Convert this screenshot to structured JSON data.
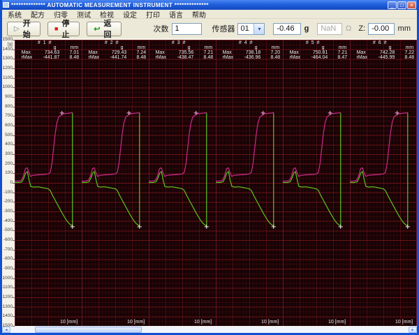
{
  "window": {
    "title": "**************  AUTOMATIC MEASUREMENT INSTRUMENT  **************",
    "controls": {
      "minimize": "_",
      "restore": "□",
      "close": "×"
    }
  },
  "menu": {
    "items": [
      "系统",
      "配方",
      "归零",
      "测试",
      "检视",
      "设定",
      "打印",
      "语言",
      "帮助"
    ]
  },
  "toolbar": {
    "start_label": "开始",
    "stop_label": "停止",
    "return_label": "返回",
    "count_label": "次数",
    "count_value": "1",
    "sensor_label": "传感器",
    "sensor_value": "01",
    "force_value": "-0.46",
    "force_unit": "g",
    "ohm_value": "NaN",
    "ohm_unit": "Ω",
    "z_label": "Z:",
    "z_value": "-0.00",
    "z_unit": "mm"
  },
  "chart_data": {
    "type": "line",
    "y_axis": {
      "unit": "[g]",
      "min": -1500,
      "max": 1500,
      "step": 100
    },
    "x_label": "10 [mm]",
    "legend_position": "none",
    "grid": true,
    "colors": {
      "press": "#cb2a8d",
      "return": "#5fc41e",
      "press_marker": "#f5b6e2",
      "return_marker": "#eaf6ea",
      "divider": "#6e1430",
      "background": "#170305"
    },
    "panels": [
      {
        "index": "# 1 #",
        "col_g": "g",
        "col_mm": "mm",
        "max_label": "Max",
        "rmax_label": "rMax",
        "max_g": "734.63",
        "max_mm": "7.01",
        "rmax_g": "-441.87",
        "rmax_mm": "8.48"
      },
      {
        "index": "# 2 #",
        "col_g": "g",
        "col_mm": "mm",
        "max_label": "Max",
        "rmax_label": "rMax",
        "max_g": "729.43",
        "max_mm": "7.24",
        "rmax_g": "-441.74",
        "rmax_mm": "8.48"
      },
      {
        "index": "# 3 #",
        "col_g": "g",
        "col_mm": "mm",
        "max_label": "Max",
        "rmax_label": "rMax",
        "max_g": "735.56",
        "max_mm": "7.21",
        "rmax_g": "-438.47",
        "rmax_mm": "8.48"
      },
      {
        "index": "# 4 #",
        "col_g": "g",
        "col_mm": "mm",
        "max_label": "Max",
        "rmax_label": "rMax",
        "max_g": "738.18",
        "max_mm": "7.20",
        "rmax_g": "-436.96",
        "rmax_mm": "8.48"
      },
      {
        "index": "# 5 #",
        "col_g": "g",
        "col_mm": "mm",
        "max_label": "Max",
        "rmax_label": "rMax",
        "max_g": "750.81",
        "max_mm": "7.21",
        "rmax_g": "-464.04",
        "rmax_mm": "8.47"
      },
      {
        "index": "# 6 #",
        "col_g": "g",
        "col_mm": "mm",
        "max_label": "Max",
        "rmax_label": "rMax",
        "max_g": "742.28",
        "max_mm": "7.22",
        "rmax_g": "-445.99",
        "rmax_mm": "8.48"
      }
    ],
    "press_curve": [
      [
        0.0,
        18
      ],
      [
        0.06,
        18
      ],
      [
        0.1,
        28
      ],
      [
        0.13,
        70
      ],
      [
        0.16,
        150
      ],
      [
        0.185,
        158
      ],
      [
        0.21,
        110
      ],
      [
        0.235,
        68
      ],
      [
        0.27,
        78
      ],
      [
        0.35,
        84
      ],
      [
        0.44,
        88
      ],
      [
        0.5,
        94
      ],
      [
        0.53,
        110
      ],
      [
        0.555,
        200
      ],
      [
        0.58,
        360
      ],
      [
        0.605,
        520
      ],
      [
        0.63,
        630
      ],
      [
        0.655,
        688
      ],
      [
        0.69,
        710
      ],
      [
        0.72,
        722
      ],
      [
        0.77,
        728
      ],
      [
        0.82,
        732
      ],
      [
        0.862,
        736
      ]
    ],
    "return_curve": [
      [
        0.0,
        4
      ],
      [
        0.07,
        4
      ],
      [
        0.11,
        12
      ],
      [
        0.14,
        55
      ],
      [
        0.165,
        105
      ],
      [
        0.19,
        118
      ],
      [
        0.215,
        30
      ],
      [
        0.24,
        -38
      ],
      [
        0.28,
        -44
      ],
      [
        0.35,
        -42
      ],
      [
        0.43,
        -52
      ],
      [
        0.5,
        -62
      ],
      [
        0.53,
        -80
      ],
      [
        0.565,
        -130
      ],
      [
        0.61,
        -190
      ],
      [
        0.66,
        -255
      ],
      [
        0.71,
        -320
      ],
      [
        0.76,
        -378
      ],
      [
        0.8,
        -418
      ],
      [
        0.835,
        -440
      ],
      [
        0.862,
        -452
      ],
      [
        0.862,
        736
      ]
    ],
    "press_marker": [
      0.705,
      733
    ],
    "return_marker": [
      0.862,
      -460
    ]
  },
  "scrollbar": {
    "left_arrow": "◄",
    "right_arrow": "►"
  }
}
